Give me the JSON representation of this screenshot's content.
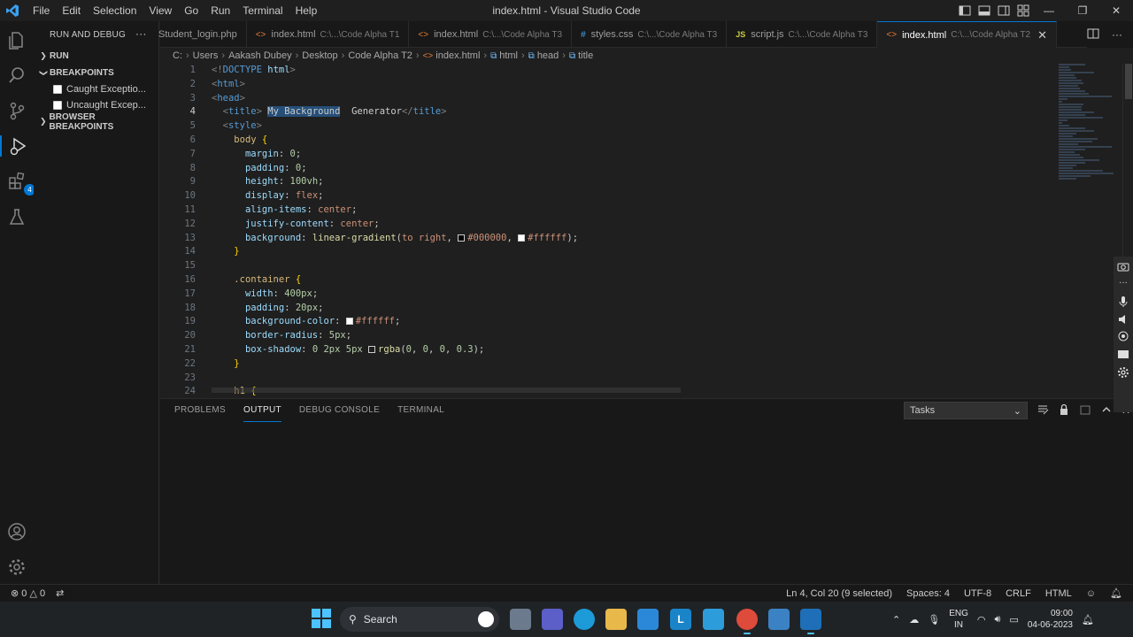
{
  "window": {
    "title": "index.html - Visual Studio Code",
    "menu": [
      "File",
      "Edit",
      "Selection",
      "View",
      "Go",
      "Run",
      "Terminal",
      "Help"
    ],
    "controls": [
      "—",
      "❐",
      "✕"
    ]
  },
  "activity_bar": {
    "items": [
      "explorer-icon",
      "search-icon",
      "source-control-icon",
      "run-debug-icon",
      "extensions-icon",
      "testing-icon"
    ],
    "extensions_badge": "4",
    "bottom": [
      "account-icon",
      "manage-gear-icon"
    ]
  },
  "sidebar": {
    "header": "RUN AND DEBUG",
    "more": "···",
    "run_section": "RUN",
    "breakpoints_section": "BREAKPOINTS",
    "breakpoints": [
      "Caught Exceptio...",
      "Uncaught Excep..."
    ],
    "browser_breakpoints_section": "BROWSER BREAKPOINTS"
  },
  "tabs": [
    {
      "icon": "",
      "name": "Student_login.php",
      "path": "",
      "active": false
    },
    {
      "icon": "<>",
      "name": "index.html",
      "path": "C:\\...\\Code Alpha T1",
      "active": false
    },
    {
      "icon": "<>",
      "name": "index.html",
      "path": "C:\\...\\Code Alpha T3",
      "active": false
    },
    {
      "icon": "#",
      "name": "styles.css",
      "path": "C:\\...\\Code Alpha T3",
      "active": false
    },
    {
      "icon": "JS",
      "name": "script.js",
      "path": "C:\\...\\Code Alpha T3",
      "active": false
    },
    {
      "icon": "<>",
      "name": "index.html",
      "path": "C:\\...\\Code Alpha T2",
      "active": true
    }
  ],
  "breadcrumb": [
    "C:",
    "Users",
    "Aakash Dubey",
    "Desktop",
    "Code Alpha T2",
    "index.html",
    "html",
    "head",
    "title"
  ],
  "editor": {
    "line_numbers": [
      "1",
      "2",
      "3",
      "4",
      "5",
      "6",
      "7",
      "8",
      "9",
      "10",
      "11",
      "12",
      "13",
      "14",
      "15",
      "16",
      "17",
      "18",
      "19",
      "20",
      "21",
      "22",
      "23",
      "24"
    ],
    "current_line": 4,
    "selected_text": "My Background",
    "colors": {
      "swatch_black": "#000000",
      "swatch_white": "#ffffff"
    }
  },
  "panel": {
    "tabs": [
      "PROBLEMS",
      "OUTPUT",
      "DEBUG CONSOLE",
      "TERMINAL"
    ],
    "active_tab": "OUTPUT",
    "output_channel": "Tasks"
  },
  "statusbar": {
    "errors": "0",
    "warnings": "0",
    "position": "Ln 4, Col 20 (9 selected)",
    "spaces": "Spaces: 4",
    "encoding": "UTF-8",
    "eol": "CRLF",
    "language": "HTML"
  },
  "taskbar": {
    "search_label": "Search",
    "lang_top": "ENG",
    "lang_bottom": "IN",
    "time": "09:00",
    "date": "04-06-2023"
  }
}
